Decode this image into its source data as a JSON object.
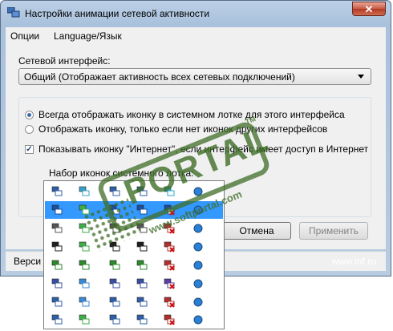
{
  "window": {
    "title": "Настройки анимации сетевой активности",
    "close_label": "✕"
  },
  "menu": {
    "items": [
      "Опции",
      "Language/Язык"
    ]
  },
  "interface": {
    "label": "Сетевой интерфейс:",
    "selected": "Общий (Отображает активность всех сетевых подключений)"
  },
  "options": {
    "radio_always": "Всегда отображать иконку в системном лотке для этого интерфейса",
    "radio_only_if_none": "Отображать иконку, только если нет иконок других интерфейсов",
    "checkbox_internet": "Показывать иконку \"Интернет\", если интерфейс имеет доступ в Интернет",
    "radio_always_checked": true,
    "checkbox_internet_checked": true
  },
  "iconset": {
    "label": "Набор иконок системного лотка:",
    "rows": 9,
    "selected_row": 2
  },
  "buttons": {
    "cancel": "Отмена",
    "apply": "Применить"
  },
  "status": {
    "version_prefix": "Верси",
    "url": "www.inf.ru"
  },
  "watermark": {
    "brand": "PORTAL",
    "tm": "TM",
    "url": "www.softportal.com"
  },
  "colors": {
    "accent": "#3399ff",
    "watermark": "#406e28"
  }
}
